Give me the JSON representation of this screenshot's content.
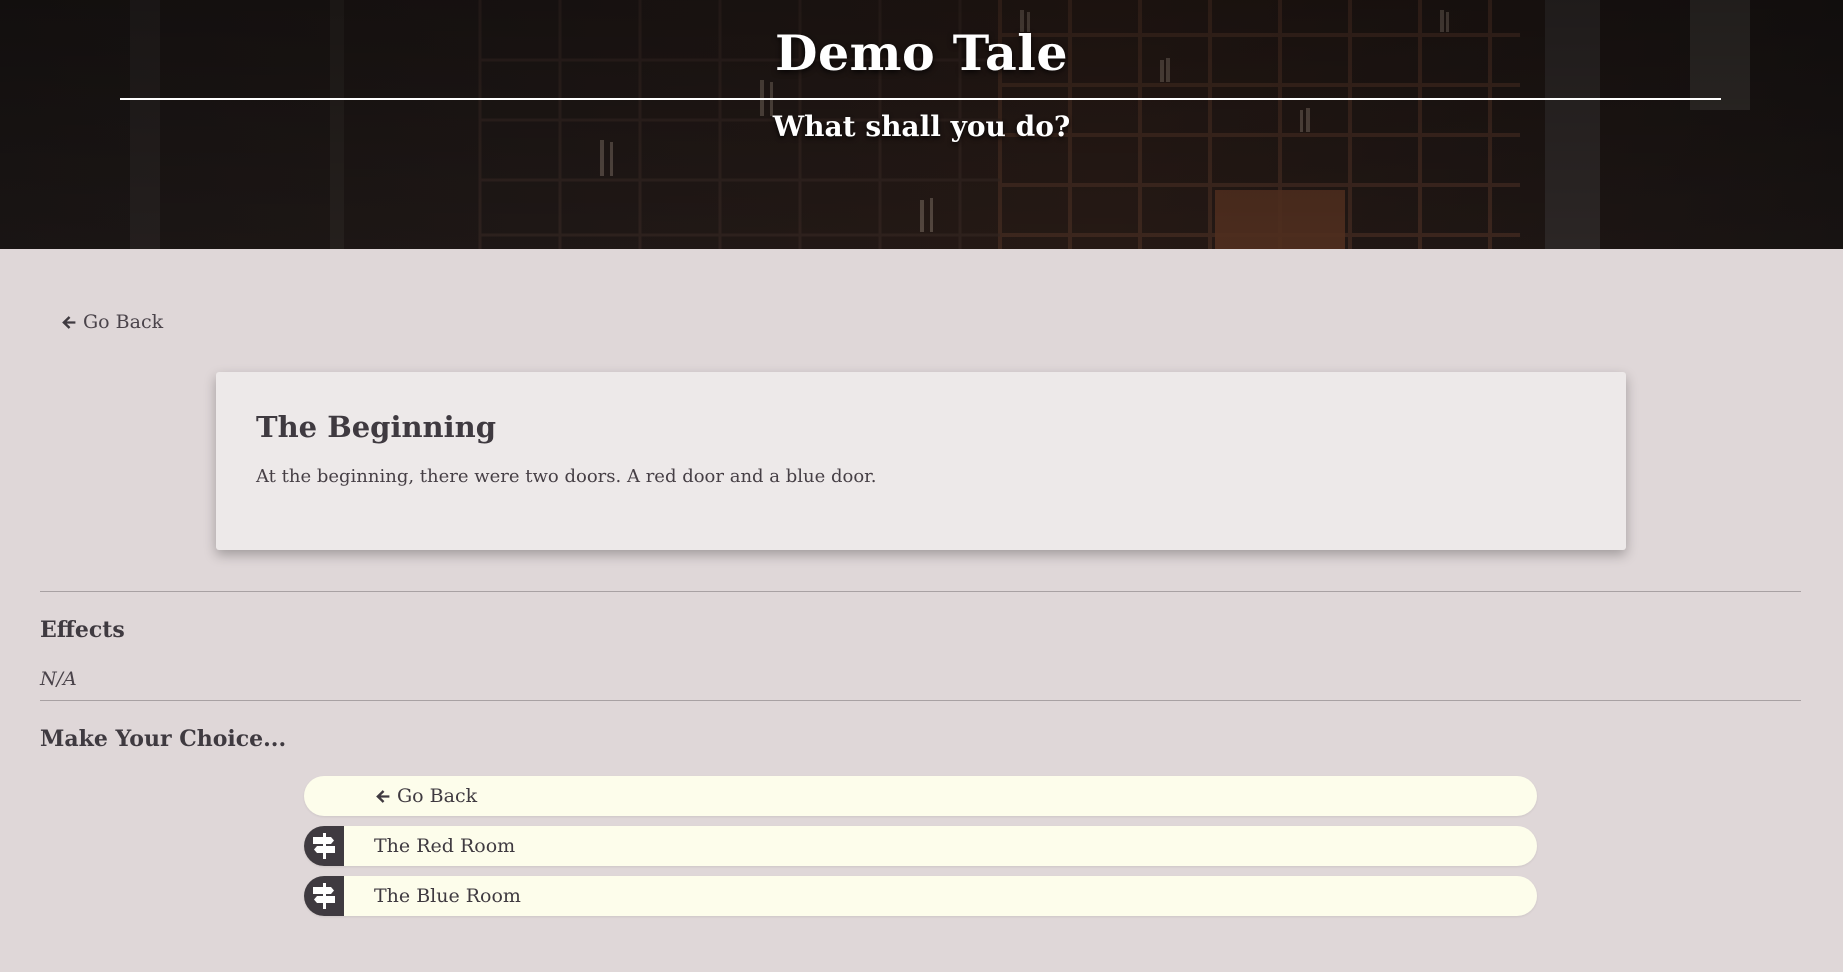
{
  "header": {
    "title": "Demo Tale",
    "subtitle": "What shall you do?"
  },
  "nav": {
    "back_label": "Go Back",
    "back_icon": "arrow-left-icon"
  },
  "passage": {
    "title": "The Beginning",
    "text": "At the beginning, there were two doors. A red door and a blue door."
  },
  "effects": {
    "heading": "Effects",
    "value": "N/A"
  },
  "choices": {
    "heading": "Make Your Choice...",
    "items": [
      {
        "label": "Go Back",
        "icon": "arrow-left-icon"
      },
      {
        "label": "The Red Room",
        "icon": "signpost-icon"
      },
      {
        "label": "The Blue Room",
        "icon": "signpost-icon"
      }
    ]
  },
  "colors": {
    "page_background": "#dfd7d8",
    "card_background": "#ede9e9",
    "choice_background": "#fdfdeb",
    "accent_dark": "#3f3a40",
    "header_text": "#ffffff"
  }
}
